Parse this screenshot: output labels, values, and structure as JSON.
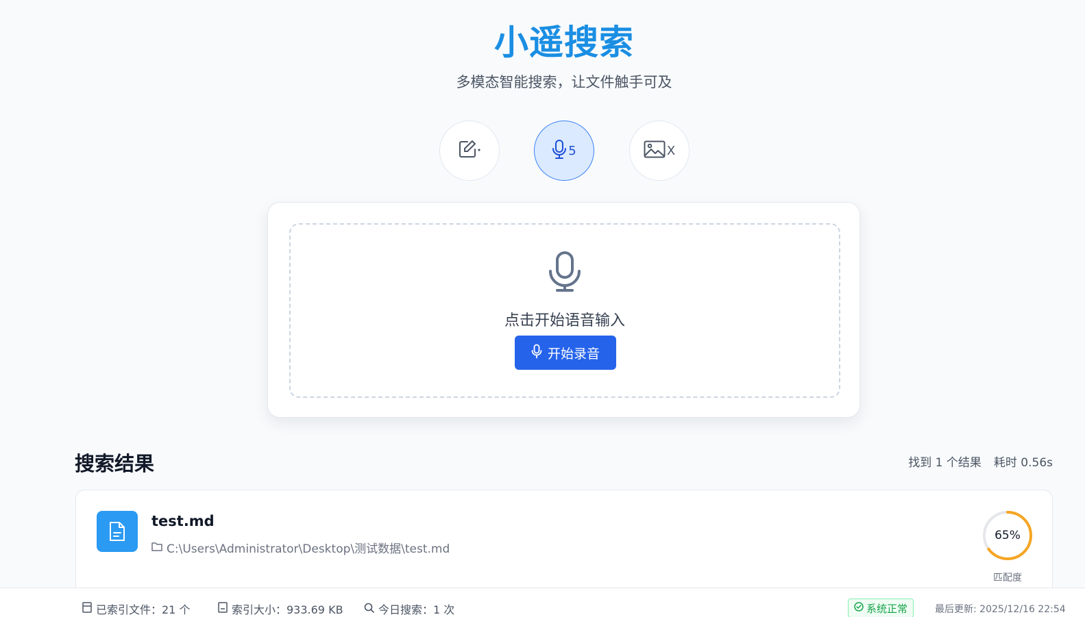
{
  "header": {
    "title": "小遥搜索",
    "subtitle": "多模态智能搜索，让文件触手可及"
  },
  "modes": [
    {
      "name": "text",
      "icon": "edit-icon",
      "badge": "",
      "active": false
    },
    {
      "name": "voice",
      "icon": "microphone-icon",
      "badge": "5",
      "active": true
    },
    {
      "name": "image",
      "icon": "image-icon",
      "badge": "X",
      "active": false
    }
  ],
  "voice_input": {
    "prompt": "点击开始语音输入",
    "record_button": "开始录音"
  },
  "results": {
    "title": "搜索结果",
    "count_text": "找到 1 个结果",
    "time_text": "耗时 0.56s",
    "items": [
      {
        "file_name": "test.md",
        "file_path": "C:\\Users\\Administrator\\Desktop\\测试数据\\test.md",
        "score_text": "65%",
        "score_fraction": 0.65,
        "score_label": "匹配度"
      }
    ]
  },
  "status_bar": {
    "indexed_files": "已索引文件：21 个",
    "index_size": "索引大小：933.69 KB",
    "today_searches": "今日搜索：1 次",
    "system_status": "系统正常",
    "last_update": "最后更新: 2025/12/16 22:54"
  },
  "colors": {
    "brand": "#1a8ee3",
    "primary_button": "#2563eb",
    "score_ring": "#f5a623",
    "status_ok": "#16a34a"
  }
}
